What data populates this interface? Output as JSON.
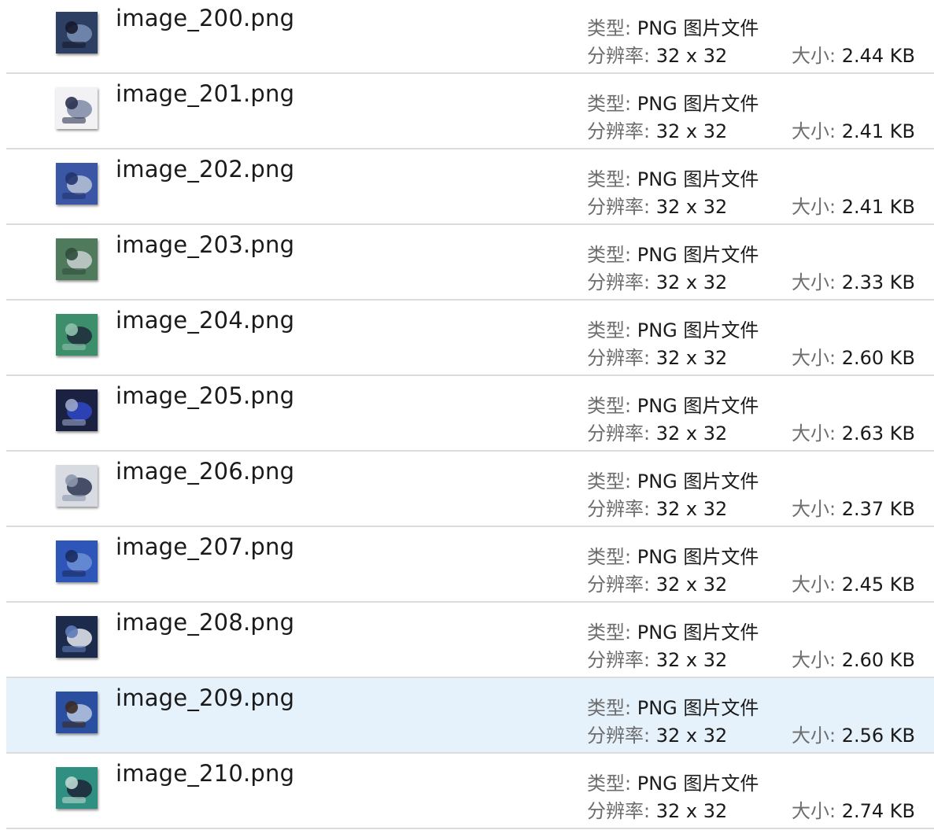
{
  "labels": {
    "type": "类型: ",
    "resolution": "分辨率: ",
    "size": "大小: "
  },
  "files": [
    {
      "name": "image_200.png",
      "type": "PNG 图片文件",
      "resolution": "32 x 32",
      "size": "2.44 KB",
      "selected": false,
      "thumb_colors": [
        "#2d3f63",
        "#7a8fb5",
        "#141a2c"
      ]
    },
    {
      "name": "image_201.png",
      "type": "PNG 图片文件",
      "resolution": "32 x 32",
      "size": "2.41 KB",
      "selected": false,
      "thumb_colors": [
        "#f2f2f4",
        "#7f8aa6",
        "#2b3350"
      ]
    },
    {
      "name": "image_202.png",
      "type": "PNG 图片文件",
      "resolution": "32 x 32",
      "size": "2.41 KB",
      "selected": false,
      "thumb_colors": [
        "#3a56a4",
        "#b9c2d8",
        "#22346e"
      ]
    },
    {
      "name": "image_203.png",
      "type": "PNG 图片文件",
      "resolution": "32 x 32",
      "size": "2.33 KB",
      "selected": false,
      "thumb_colors": [
        "#4f7a5c",
        "#c8d0cf",
        "#2f4d3b"
      ]
    },
    {
      "name": "image_204.png",
      "type": "PNG 图片文件",
      "resolution": "32 x 32",
      "size": "2.60 KB",
      "selected": false,
      "thumb_colors": [
        "#3d8f6b",
        "#1d2a3a",
        "#8fc2ad"
      ]
    },
    {
      "name": "image_205.png",
      "type": "PNG 图片文件",
      "resolution": "32 x 32",
      "size": "2.63 KB",
      "selected": false,
      "thumb_colors": [
        "#1b2140",
        "#2f46c8",
        "#9aa6c8"
      ]
    },
    {
      "name": "image_206.png",
      "type": "PNG 图片文件",
      "resolution": "32 x 32",
      "size": "2.37 KB",
      "selected": false,
      "thumb_colors": [
        "#d8dbe2",
        "#2b3550",
        "#8d97ad"
      ]
    },
    {
      "name": "image_207.png",
      "type": "PNG 图片文件",
      "resolution": "32 x 32",
      "size": "2.45 KB",
      "selected": false,
      "thumb_colors": [
        "#2d56b8",
        "#6f8fd6",
        "#1a2c60"
      ]
    },
    {
      "name": "image_208.png",
      "type": "PNG 图片文件",
      "resolution": "32 x 32",
      "size": "2.60 KB",
      "selected": false,
      "thumb_colors": [
        "#1c2a4c",
        "#e6eaf0",
        "#5d7bb8"
      ]
    },
    {
      "name": "image_209.png",
      "type": "PNG 图片文件",
      "resolution": "32 x 32",
      "size": "2.56 KB",
      "selected": true,
      "thumb_colors": [
        "#2a4fa0",
        "#b7c6e0",
        "#3b2a22"
      ]
    },
    {
      "name": "image_210.png",
      "type": "PNG 图片文件",
      "resolution": "32 x 32",
      "size": "2.74 KB",
      "selected": false,
      "thumb_colors": [
        "#2f8f80",
        "#1c2536",
        "#bcd8d0"
      ]
    }
  ]
}
